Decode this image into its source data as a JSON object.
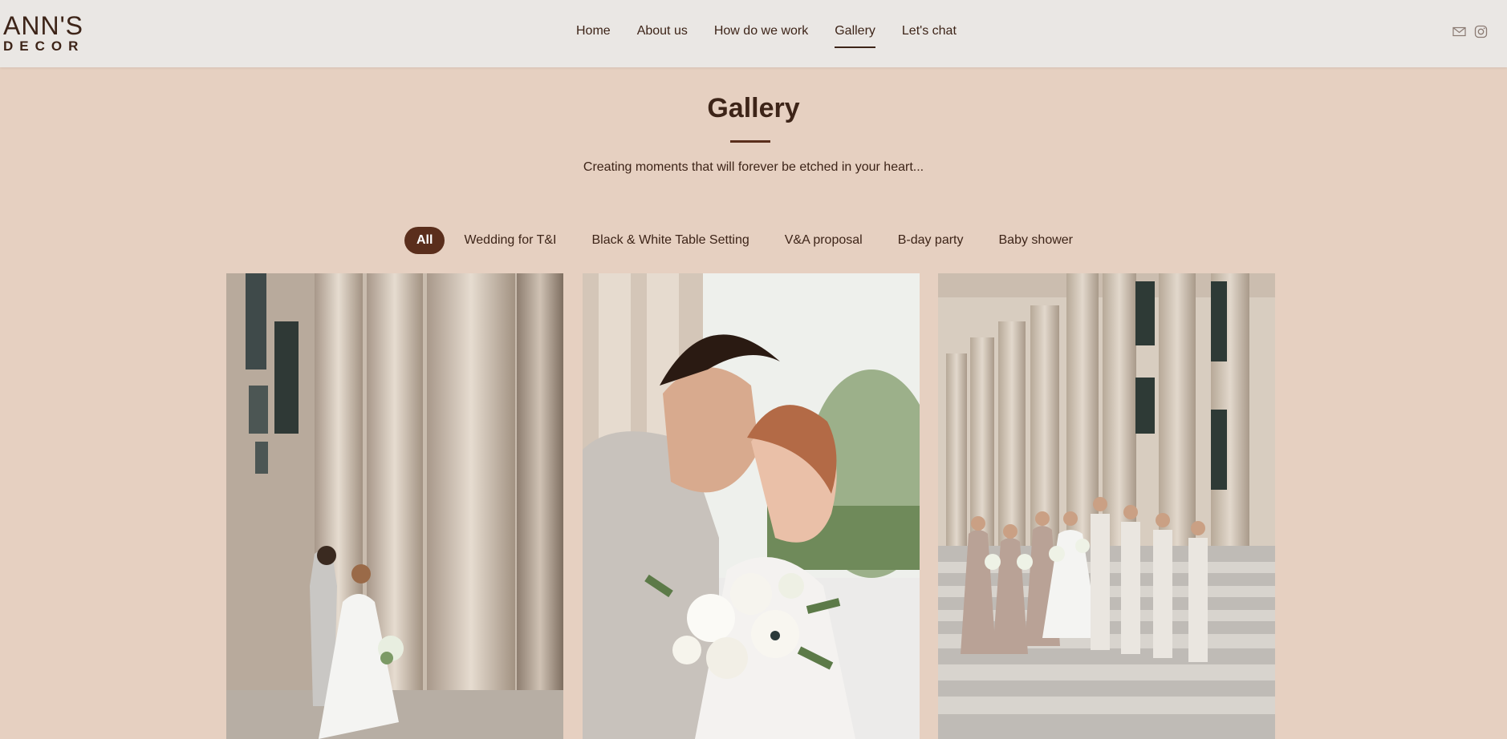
{
  "logo": {
    "line1": "ANN'S",
    "line2": "DECOR"
  },
  "nav": {
    "items": [
      {
        "label": "Home"
      },
      {
        "label": "About us"
      },
      {
        "label": "How do we work"
      },
      {
        "label": "Gallery"
      },
      {
        "label": "Let's chat"
      }
    ],
    "active": "Gallery"
  },
  "header_icons": [
    "mail-icon",
    "instagram-icon"
  ],
  "page": {
    "title": "Gallery",
    "subtitle": "Creating moments that will forever be etched in your heart..."
  },
  "filters": {
    "items": [
      {
        "label": "All"
      },
      {
        "label": "Wedding for T&I"
      },
      {
        "label": "Black & White Table Setting"
      },
      {
        "label": "V&A proposal"
      },
      {
        "label": "B-day party"
      },
      {
        "label": "Baby shower"
      }
    ],
    "active": "All"
  },
  "colors": {
    "background": "#e6d0c1",
    "header": "#eae7e4",
    "accent": "#5a2e1c",
    "text": "#3d2418"
  }
}
